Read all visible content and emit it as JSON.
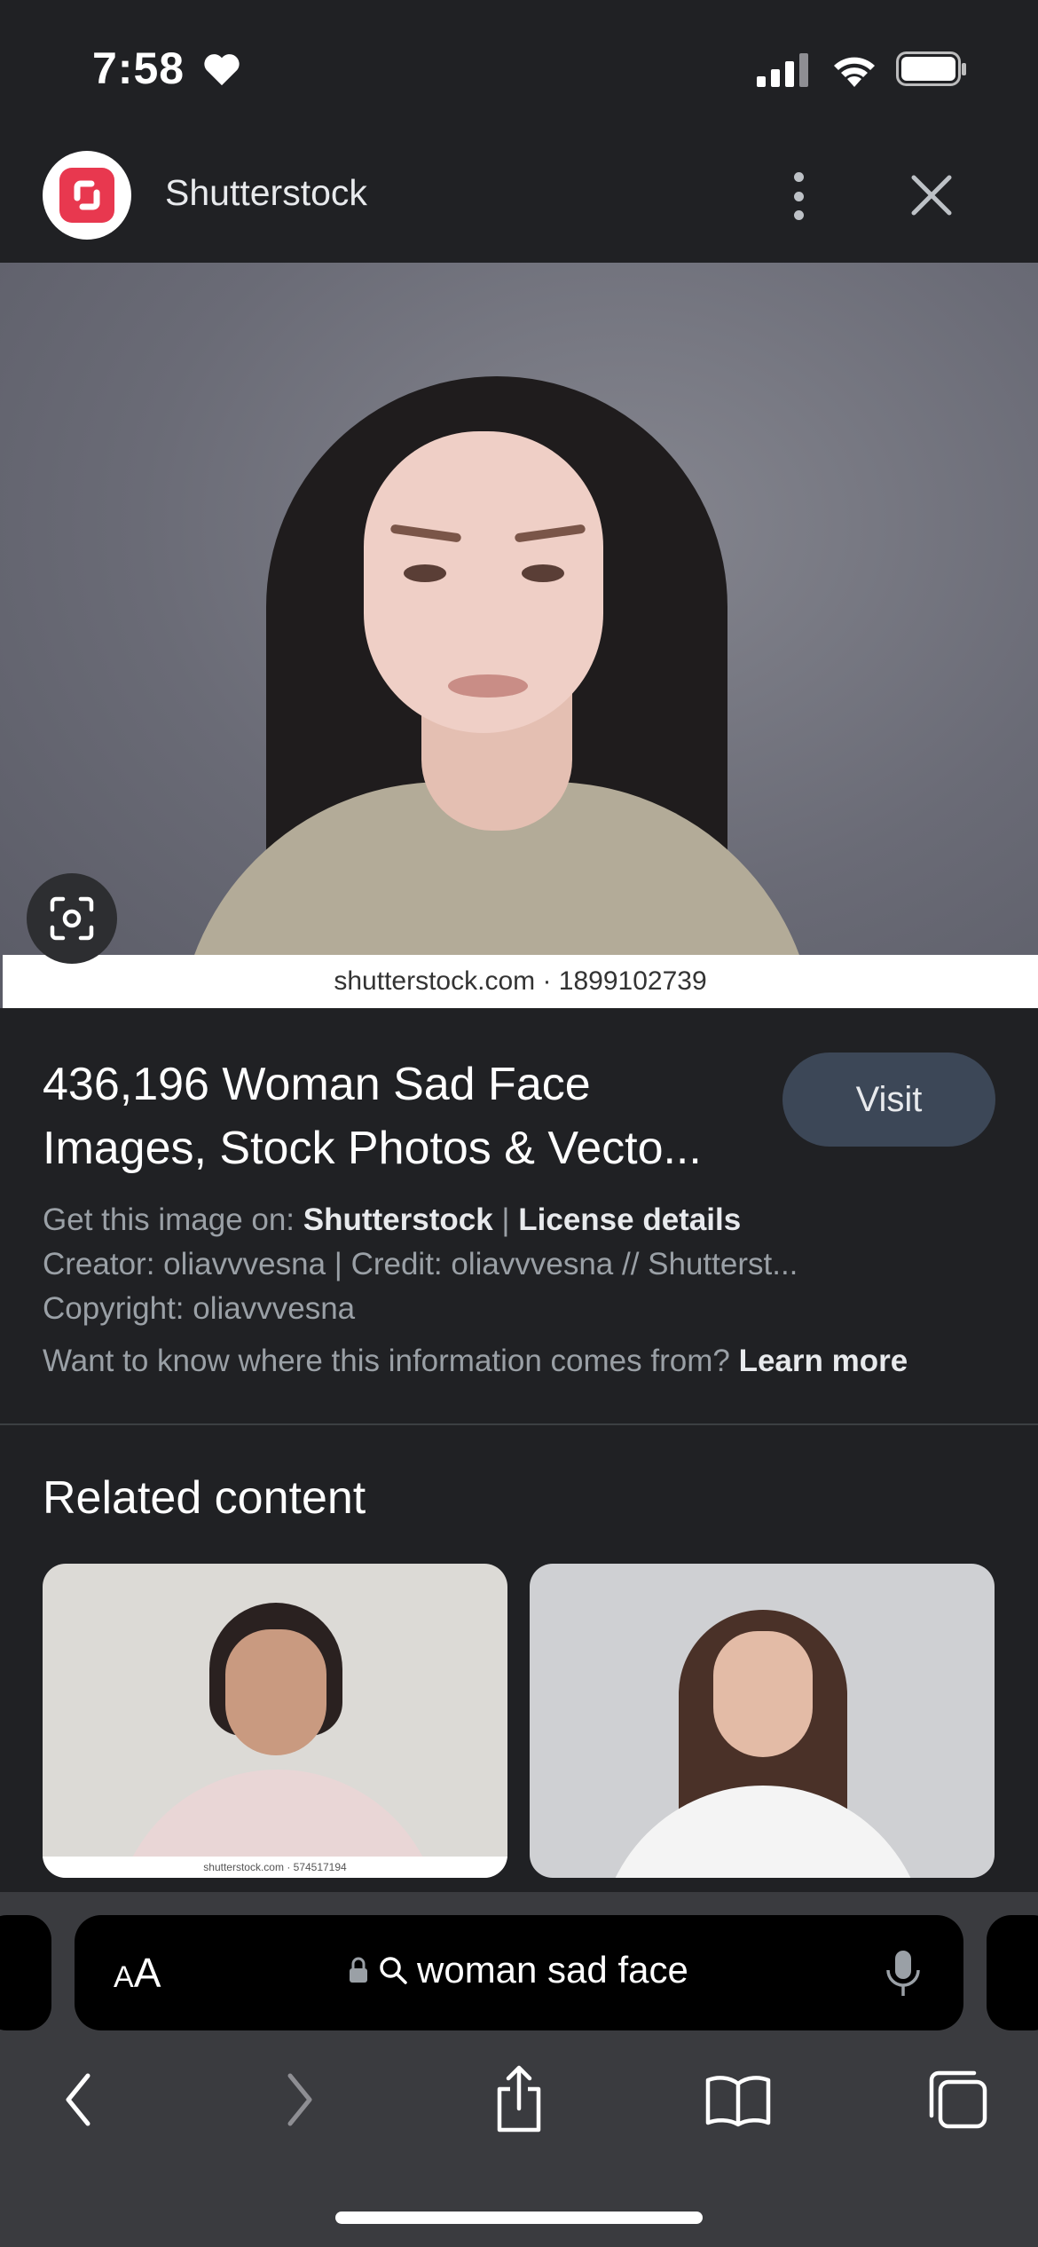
{
  "status_bar": {
    "time": "7:58"
  },
  "header": {
    "source_name": "Shutterstock"
  },
  "main_image": {
    "watermark": "shutterstock.com · 1899102739"
  },
  "result": {
    "title_line1": "436,196 Woman Sad Face",
    "title_line2": "Images, Stock Photos & Vecto...",
    "visit_label": "Visit",
    "get_prefix": "Get this image on: ",
    "get_source": "Shutterstock",
    "separator": " | ",
    "license_label": "License details",
    "creator_line": "Creator: oliavvvesna | Credit: oliavvvesna // Shutterst...",
    "copyright_line": "Copyright: oliavvvesna",
    "learn_prefix": "Want to know where this information comes from? ",
    "learn_more_label": "Learn more"
  },
  "related": {
    "heading": "Related content",
    "thumb1_watermark": "shutterstock.com · 574517194"
  },
  "address_bar": {
    "aa_small": "A",
    "aa_large": "A",
    "query": "woman sad face"
  },
  "colors": {
    "background": "#202124",
    "visit_button": "#3c4757",
    "toolbar": "#3a3b3f",
    "logo_red": "#e8384f"
  },
  "icons": [
    "heart-icon",
    "signal-icon",
    "wifi-icon",
    "battery-icon",
    "more-vert-icon",
    "close-icon",
    "lens-icon",
    "lock-icon",
    "search-icon",
    "mic-icon",
    "back-icon",
    "forward-icon",
    "share-icon",
    "bookmarks-icon",
    "tabs-icon"
  ]
}
